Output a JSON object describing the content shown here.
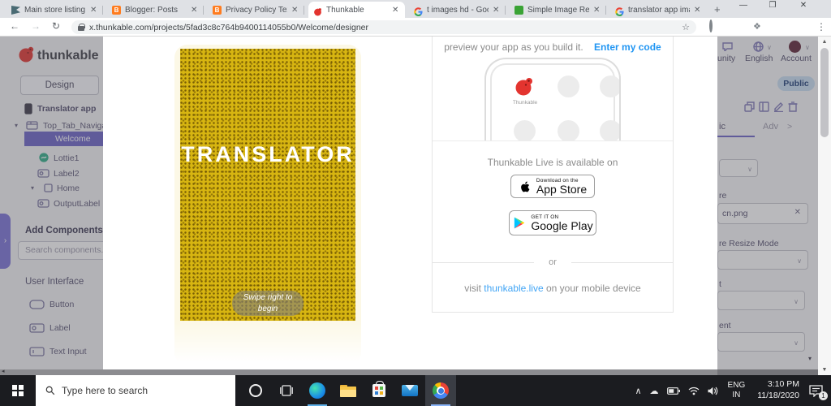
{
  "colors": {
    "accent_purple": "#6b63c7",
    "thunkable_red": "#e3342f",
    "link_blue": "#2196f3",
    "preview_yellow": "#d7b511",
    "public_badge_bg": "#c9def2"
  },
  "browser": {
    "tabs": [
      {
        "label": "Main store listing",
        "icon": "flag-icon",
        "active": false
      },
      {
        "label": "Blogger: Posts",
        "icon": "blogger-icon",
        "active": false
      },
      {
        "label": "Privacy Policy Tex",
        "icon": "blogger-icon",
        "active": false
      },
      {
        "label": "Thunkable",
        "icon": "thunkable-icon",
        "active": true
      },
      {
        "label": "t images hd - Goo",
        "icon": "google-icon",
        "active": false
      },
      {
        "label": "Simple Image Res",
        "icon": "resizer-icon",
        "active": false
      },
      {
        "label": "translator app ima",
        "icon": "google-icon",
        "active": false
      }
    ],
    "blogger_favicon_letter": "B",
    "url": "x.thunkable.com/projects/5fad3c8c764b9400114055b0/Welcome/designer"
  },
  "header": {
    "brand": "thunkable",
    "nav_community_fragment": "unity",
    "nav_language": "English",
    "nav_account": "Account",
    "visibility_badge": "Public"
  },
  "sidebar": {
    "design_tab": "Design",
    "tree": [
      {
        "label": "Translator app"
      },
      {
        "label": "Top_Tab_Navigat"
      },
      {
        "label": "Welcome",
        "selected": true
      },
      {
        "label": "Lottie1"
      },
      {
        "label": "Label2"
      },
      {
        "label": "Home"
      },
      {
        "label": "OutputLabel"
      }
    ],
    "add_components_title": "Add Components",
    "search_placeholder": "Search components...",
    "section_user_interface": "User Interface",
    "components": [
      {
        "label": "Button"
      },
      {
        "label": "Label"
      },
      {
        "label": "Text Input"
      }
    ]
  },
  "phone_preview": {
    "title": "TRANSLATOR",
    "swipe_hint_line1": "Swipe right to",
    "swipe_hint_line2": "begin"
  },
  "live_panel": {
    "intro": "preview your app as you build it.",
    "enter_code_link": "Enter my code",
    "phone_app_label": "Thunkable",
    "available_text": "Thunkable Live is available on",
    "appstore_line1": "Download on the",
    "appstore_line2": "App Store",
    "gplay_line1": "GET IT ON",
    "gplay_line2": "Google Play",
    "or_text": "or",
    "visit_prefix": "visit ",
    "visit_link": "thunkable.live",
    "visit_suffix": " on your mobile device"
  },
  "properties": {
    "tab_basic_fragment": "ic",
    "tab_advanced_fragment": "Adv",
    "tab_arrow": ">",
    "picture_label_fragment": "re",
    "picture_value_fragment": "cn.png",
    "resize_mode_label_fragment": "re Resize Mode",
    "label_fragment_1": "t",
    "label_fragment_2": "ent"
  },
  "taskbar": {
    "search_placeholder": "Type here to search",
    "lang_line1": "ENG",
    "lang_line2": "IN",
    "time": "3:10 PM",
    "date": "11/18/2020",
    "notification_count": "1"
  }
}
